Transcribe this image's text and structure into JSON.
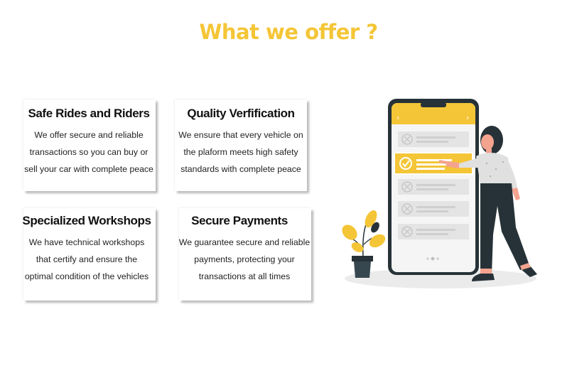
{
  "section": {
    "title": "What we offer ?"
  },
  "cards": [
    {
      "title": "Safe Rides and Riders",
      "lines": [
        "We offer secure and reliable",
        "transactions so you can buy or",
        "sell your car with complete peace"
      ]
    },
    {
      "title": "Quality Verfification",
      "lines": [
        "We ensure that every vehicle on",
        "the plaform meets high safety",
        "standards with complete peace"
      ]
    },
    {
      "title": "Specialized Workshops",
      "lines": [
        "We have technical workshops",
        "that certify and ensure the",
        "optimal condition of the vehicles"
      ]
    },
    {
      "title": "Secure Payments",
      "lines": [
        "We guarantee secure and reliable",
        "payments, protecting your",
        "transactions at all times"
      ]
    }
  ],
  "colors": {
    "accent": "#f4c536",
    "text": "#111111",
    "phone_frame": "#263238",
    "phone_screen": "#f2f2f2"
  },
  "illustration": {
    "icon": "phone-checklist-illustration"
  }
}
